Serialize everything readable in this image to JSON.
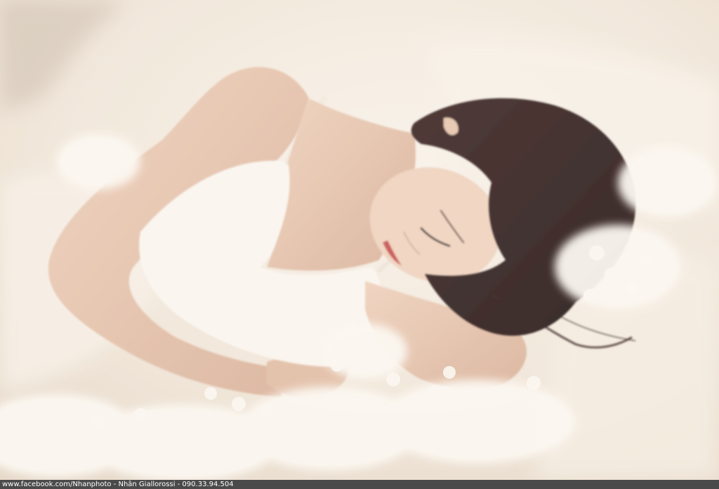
{
  "photo": {
    "subject": "woman-sleeping-on-white-tulle",
    "palette": {
      "background": "#f3ebe0",
      "fabric": "#f7f1e8",
      "skin": "#e9c9b3",
      "skin_shadow": "#c99e86",
      "hair": "#2a1a1a",
      "lips": "#c7504f",
      "flowers": "#fbf8f3"
    }
  },
  "watermark": {
    "text": "www.facebook.com/Nhanphoto - Nhân Giallorossi - 090.33.94.504",
    "bar_color": "#4a4a4a",
    "text_color": "#ffffff"
  }
}
